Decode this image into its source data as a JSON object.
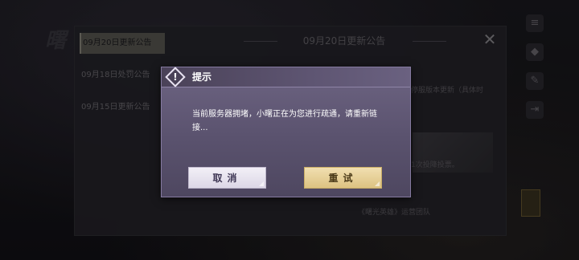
{
  "panel": {
    "tabs": [
      {
        "label": "09月20日更新公告"
      },
      {
        "label": "09月18日处罚公告"
      },
      {
        "label": "09月15日更新公告"
      }
    ],
    "title": "09月20日更新公告",
    "snippets": {
      "right_top": "停服版本更新（具体时",
      "right_mid": "1次投降投票。",
      "footer": "《曙光英雄》运营团队"
    }
  },
  "dialog": {
    "title": "提示",
    "message": "当前服务器拥堵，小曙正在为您进行疏通，请重新链接...",
    "cancel_label": "取消",
    "retry_label": "重试"
  },
  "colors": {
    "dialog_bg": "#5e5572",
    "retry_button": "#dcc282",
    "cancel_button": "#e9e5f0"
  }
}
